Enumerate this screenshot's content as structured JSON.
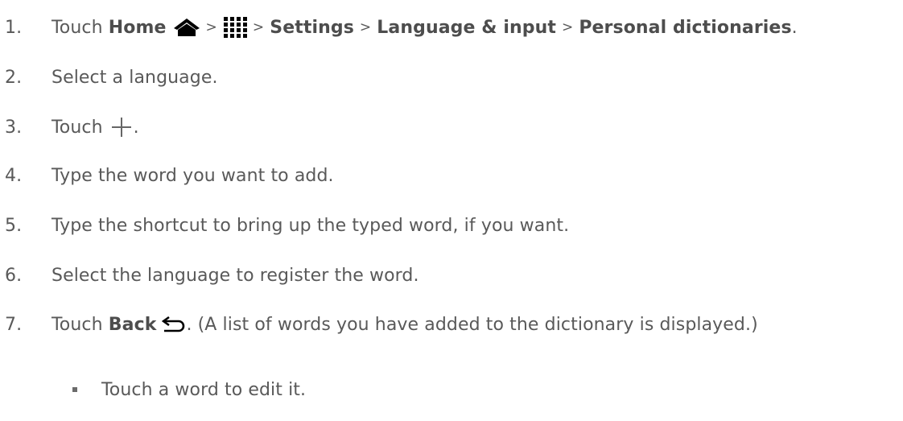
{
  "steps": [
    {
      "number": "1.",
      "touch": "Touch",
      "home": "Home",
      "sep1": ">",
      "sep2": ">",
      "settings": "Settings",
      "sep3": ">",
      "language": "Language & input",
      "sep4": ">",
      "dictionaries": "Personal dictionaries",
      "end": "."
    },
    {
      "number": "2.",
      "text": "Select a language."
    },
    {
      "number": "3.",
      "touch": "Touch",
      "end": "."
    },
    {
      "number": "4.",
      "text": "Type the word you want to add."
    },
    {
      "number": "5.",
      "text": "Type the shortcut to bring up the typed word, if you want."
    },
    {
      "number": "6.",
      "text": "Select the language to register the word."
    },
    {
      "number": "7.",
      "touch": "Touch",
      "back": "Back",
      "rest": ". (A list of words you have added to the dictionary is displayed.)"
    }
  ],
  "sub_bullet": "Touch a word to edit it.",
  "icons": [
    "home-icon",
    "apps-grid-icon",
    "add-icon",
    "back-arrow-icon"
  ]
}
